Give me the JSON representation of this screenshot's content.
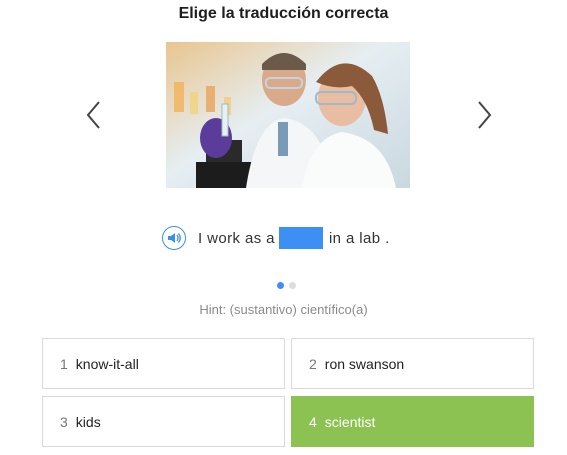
{
  "header": {
    "title": "Elige la traducción correcta"
  },
  "sentence": {
    "before": "I work as a",
    "after": "in a lab ."
  },
  "carousel": {
    "pages": 2,
    "active_page": 1
  },
  "hint": "Hint: (sustantivo) científico(a)",
  "options": [
    {
      "number": "1",
      "label": "know-it-all",
      "selected": false
    },
    {
      "number": "2",
      "label": "ron swanson",
      "selected": false
    },
    {
      "number": "3",
      "label": "kids",
      "selected": false
    },
    {
      "number": "4",
      "label": "scientist",
      "selected": true
    }
  ],
  "colors": {
    "accent_blue": "#3b8ff5",
    "selected_green": "#8cc251"
  },
  "icons": {
    "prev": "chevron-left-icon",
    "next": "chevron-right-icon",
    "audio": "speaker-icon"
  }
}
